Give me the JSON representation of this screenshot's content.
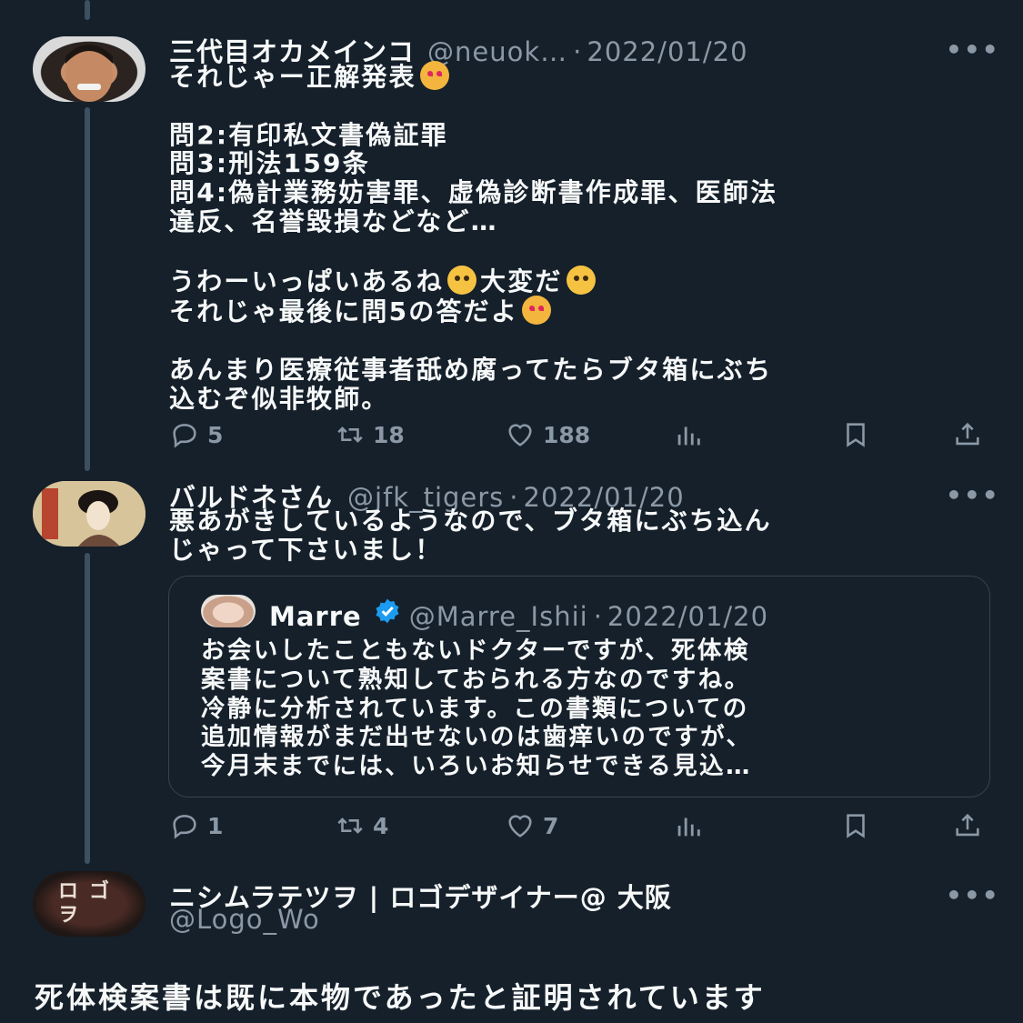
{
  "tweets": [
    {
      "name": "三代目オカメインコ",
      "handle": "@neuok…",
      "date": "2022/01/20",
      "text_lines": [
        "それじゃー正解発表",
        "",
        "問2:有印私文書偽証罪",
        "問3:刑法159条",
        "問4:偽計業務妨害罪、虚偽診断書作成罪、医師法",
        "違反、名誉毀損などなど…",
        "",
        "うわーいっぱいあるね",
        "それじゃ最後に問5の答だよ",
        "",
        "あんまり医療従事者舐め腐ってたらブタ箱にぶち",
        "込むぞ似非牧師。"
      ],
      "emoji_inline_1": "大変だ",
      "replies": "5",
      "retweets": "18",
      "likes": "188"
    },
    {
      "name": "バルドネさん",
      "handle": "@jfk_tigers",
      "date": "2022/01/20",
      "text_line_1": "悪あがきしているようなので、ブタ箱にぶち込ん",
      "text_line_2": "じゃって下さいまし！",
      "replies": "1",
      "retweets": "4",
      "likes": "7",
      "quote": {
        "name": "Marre",
        "handle": "@Marre_Ishii",
        "date": "2022/01/20",
        "text": "お会いしたこともないドクターですが、死体検\n案書について熟知しておられる方なのですね。\n冷静に分析されています。この書類についての\n追加情報がまだ出せないのは歯痒いのですが、\n今月末までには、いろいお知らせできる見込…"
      }
    },
    {
      "name": "ニシムラテツヲ | ロゴデザイナー@ 大阪",
      "handle": "@Logo_Wo",
      "avatar_text": "ロゴヲ",
      "text": "死体検案書は既に本物であったと証明されています"
    }
  ],
  "ui": {
    "dot": "·",
    "more": "•••"
  },
  "icons": [
    "reply-icon",
    "retweet-icon",
    "like-icon",
    "views-icon",
    "bookmark-icon",
    "share-icon",
    "verified-icon",
    "more-icon"
  ],
  "colors": {
    "background": "#15202b",
    "muted": "#8b98a5",
    "verified": "#1d9bf0",
    "thread_line": "#3d4f61"
  }
}
